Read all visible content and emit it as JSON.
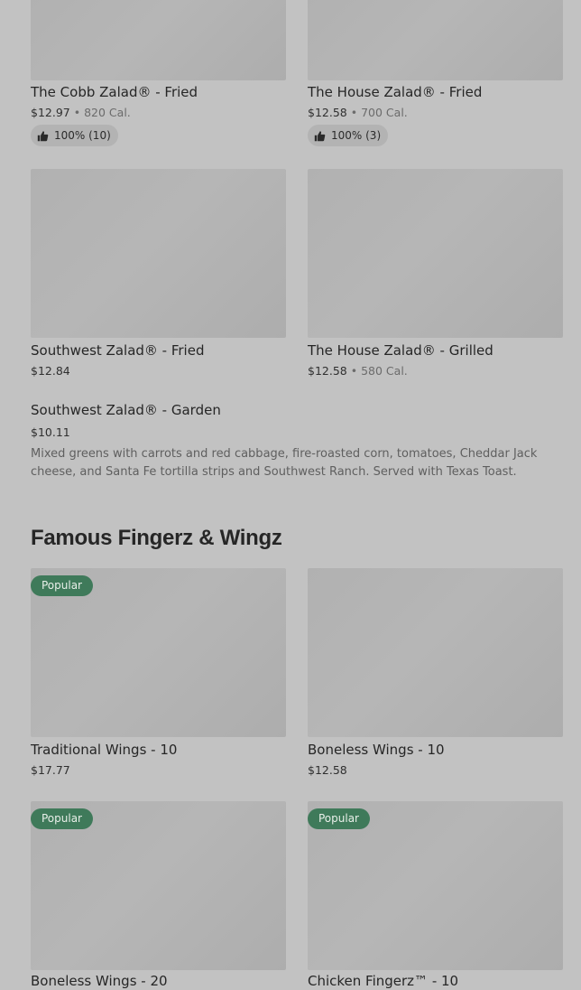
{
  "salads": {
    "cobb_fried": {
      "title": "The Cobb Zalad® - Fried",
      "price": "$12.97",
      "calories": "820 Cal.",
      "rating": "100% (10)"
    },
    "house_fried": {
      "title": "The House Zalad® - Fried",
      "price": "$12.58",
      "calories": "700 Cal.",
      "rating": "100% (3)"
    },
    "southwest_fried": {
      "title": "Southwest Zalad® - Fried",
      "price": "$12.84"
    },
    "house_grilled": {
      "title": "The House Zalad® - Grilled",
      "price": "$12.58",
      "calories": "580 Cal."
    },
    "southwest_garden": {
      "title": "Southwest Zalad® - Garden",
      "price": "$10.11",
      "description": "Mixed greens with carrots and red cabbage, fire-roasted corn, tomatoes, Cheddar Jack cheese, and Santa Fe tortilla strips and Southwest Ranch. Served with Texas Toast."
    }
  },
  "separator": "•",
  "fingerz_section": {
    "title": "Famous Fingerz & Wingz",
    "badge_label": "Popular",
    "items": {
      "traditional_wings_10": {
        "title": "Traditional Wings - 10",
        "price": "$17.77"
      },
      "boneless_wings_10": {
        "title": "Boneless Wings - 10",
        "price": "$12.58"
      },
      "boneless_wings_20": {
        "title": "Boneless Wings - 20"
      },
      "chicken_fingerz_10": {
        "title": "Chicken Fingerz™ - 10"
      }
    }
  },
  "icons": {
    "rating": "thumbs-up-icon"
  },
  "colors": {
    "background": "#c2c2c2",
    "image_placeholder": "#b3b3b3",
    "popular_badge": "#3f7a5a",
    "rating_pill": "#b3b3b3"
  }
}
